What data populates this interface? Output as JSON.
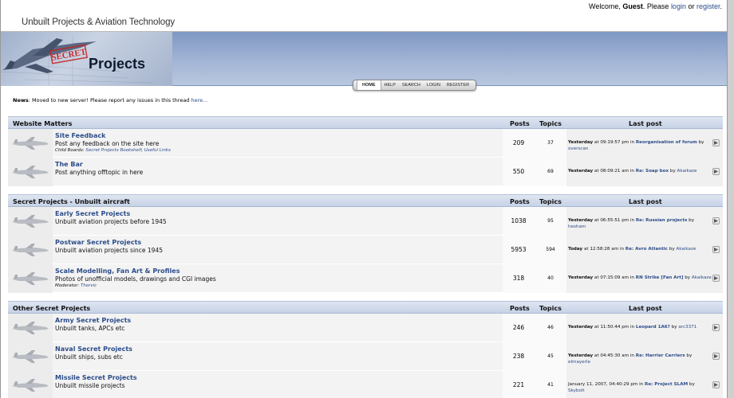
{
  "header": {
    "site_title": "Unbuilt Projects & Aviation Technology",
    "welcome_prefix": "Welcome, ",
    "guest": "Guest",
    "please": ". Please ",
    "login": "login",
    "or": " or ",
    "register": "register",
    "period": "."
  },
  "banner": {
    "logo_stamp": "SECRET",
    "logo_text": "Projects"
  },
  "menu": [
    {
      "label": "HOME",
      "active": true
    },
    {
      "label": "HELP"
    },
    {
      "label": "SEARCH"
    },
    {
      "label": "LOGIN"
    },
    {
      "label": "REGISTER"
    }
  ],
  "news": {
    "label": "News",
    "text": ": Moved to new server! Please report any issues in this thread ",
    "link": "here..."
  },
  "columns": {
    "posts": "Posts",
    "topics": "Topics",
    "last_post": "Last post"
  },
  "categories": [
    {
      "title": "Website Matters",
      "boards": [
        {
          "name": "Site Feedback",
          "desc": "Post any feedback on the site here",
          "sub_label": "Child Boards: ",
          "sub_links": [
            "Secret Projects Bookshelf",
            "Useful Links"
          ],
          "posts": "209",
          "topics": "37",
          "last": {
            "when": "Yesterday",
            "time": " at 09:19:57 pm in ",
            "topic": "Reorganisation of forum",
            "by": " by ",
            "user": "overscan"
          }
        },
        {
          "name": "The Bar",
          "desc": "Post anything offtopic in here",
          "posts": "550",
          "topics": "69",
          "last": {
            "when": "Yesterday",
            "time": " at 08:09:21 am in ",
            "topic": "Re: Soap box",
            "by": " by ",
            "user": "Akaikaze"
          }
        }
      ]
    },
    {
      "title": "Secret Projects - Unbuilt aircraft",
      "boards": [
        {
          "name": "Early Secret Projects",
          "desc": "Unbuilt aviation projects before 1945",
          "posts": "1038",
          "topics": "95",
          "last": {
            "when": "Yesterday",
            "time": " at 06:55:51 pm in ",
            "topic": "Re: Russian projects",
            "by": " by ",
            "user": "hesham"
          }
        },
        {
          "name": "Postwar Secret Projects",
          "desc": "Unbuilt aviation projects since 1945",
          "posts": "5953",
          "topics": "594",
          "last": {
            "when": "Today",
            "time": " at 12:58:28 am in ",
            "topic": "Re: Avro Atlantic",
            "by": " by ",
            "user": "Akaikaze"
          }
        },
        {
          "name": "Scale Modelling, Fan Art & Profiles",
          "desc": "Photos of unofficial models, drawings and CGI images",
          "sub_label": "Moderator: ",
          "sub_links": [
            "Thorvic"
          ],
          "posts": "318",
          "topics": "40",
          "last": {
            "when": "Yesterday",
            "time": " at 07:15:09 am in ",
            "topic": "RN Strike [Fan Art]",
            "by": " by ",
            "user": "Akaikaze"
          }
        }
      ]
    },
    {
      "title": "Other Secret Projects",
      "boards": [
        {
          "name": "Army Secret Projects",
          "desc": "Unbuilt tanks, APCs etc",
          "posts": "246",
          "topics": "46",
          "last": {
            "when": "Yesterday",
            "time": " at 11:50:44 pm in ",
            "topic": "Leopard 1A6?",
            "by": " by ",
            "user": "arc3371"
          }
        },
        {
          "name": "Naval Secret Projects",
          "desc": "Unbuilt ships, subs etc",
          "posts": "238",
          "topics": "45",
          "last": {
            "when": "Yesterday",
            "time": " at 04:45:30 am in ",
            "topic": "Re: Harrier Carriers",
            "by": " by ",
            "user": "elmayerle"
          }
        },
        {
          "name": "Missile Secret Projects",
          "desc": "Unbuilt missile projects",
          "posts": "221",
          "topics": "41",
          "last": {
            "when": "",
            "time": "January 11, 2007, 04:40:29 pm in ",
            "topic": "Re: Project SLAM",
            "by": " by ",
            "user": "Skybolt"
          }
        }
      ]
    }
  ]
}
